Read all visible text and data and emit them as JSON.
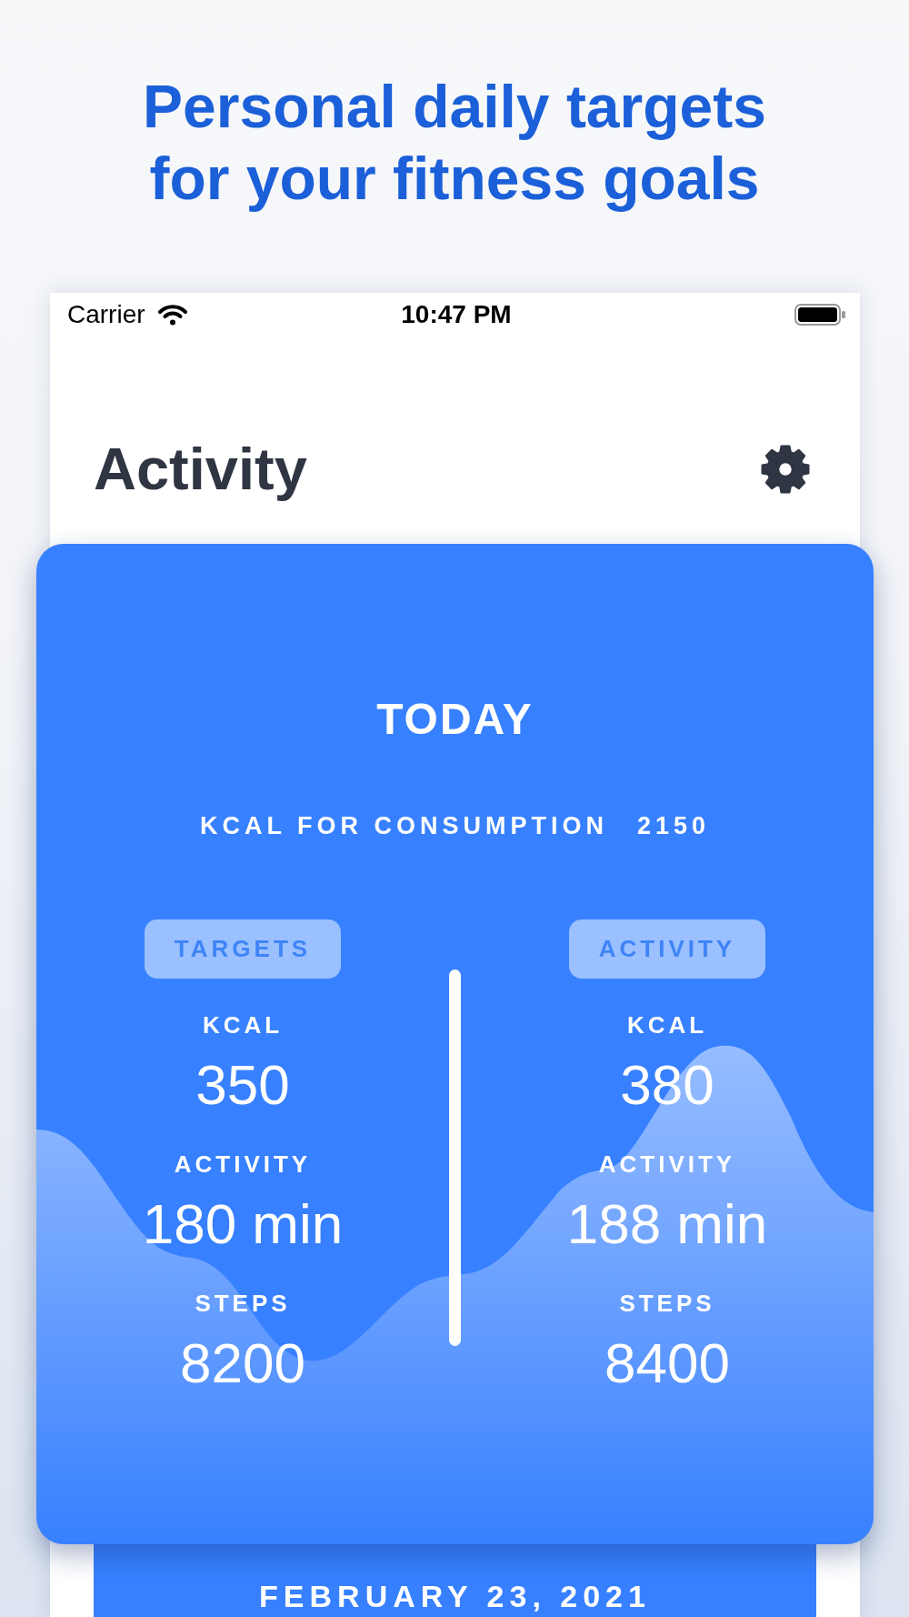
{
  "headline": "Personal daily targets for your fitness goals",
  "status_bar": {
    "carrier": "Carrier",
    "time": "10:47 PM"
  },
  "nav": {
    "title": "Activity"
  },
  "today_card": {
    "title": "TODAY",
    "consumption": {
      "label": "KCAL FOR CONSUMPTION",
      "value": "2150"
    },
    "columns": [
      {
        "header": "TARGETS",
        "metrics": [
          {
            "label": "KCAL",
            "value": "350"
          },
          {
            "label": "ACTIVITY",
            "value": "180 min"
          },
          {
            "label": "STEPS",
            "value": "8200"
          }
        ]
      },
      {
        "header": "ACTIVITY",
        "metrics": [
          {
            "label": "KCAL",
            "value": "380"
          },
          {
            "label": "ACTIVITY",
            "value": "188 min"
          },
          {
            "label": "STEPS",
            "value": "8400"
          }
        ]
      }
    ]
  },
  "date_banner": {
    "date": "FEBRUARY 23, 2021"
  }
}
